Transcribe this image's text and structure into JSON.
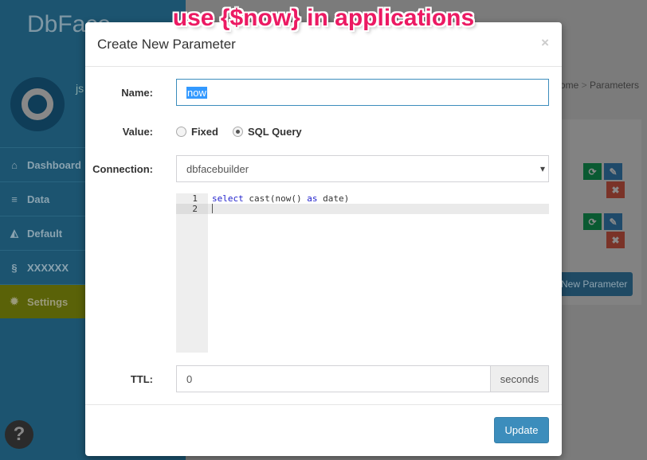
{
  "app": {
    "brand": "DbFace",
    "user": "js"
  },
  "sidebar": {
    "items": [
      {
        "label": "Dashboard",
        "icon": "home-icon"
      },
      {
        "label": "Data",
        "icon": "database-icon"
      },
      {
        "label": "Default",
        "icon": "area-chart-icon"
      },
      {
        "label": "XXXXXX",
        "icon": "unlink-icon"
      },
      {
        "label": "Settings",
        "icon": "gear-icon",
        "active": true
      }
    ]
  },
  "breadcrumb": {
    "home": "ome",
    "sep": ">",
    "current": "Parameters"
  },
  "page": {
    "new_parameter": "New Parameter"
  },
  "banner": "use {$now} in applications",
  "modal": {
    "title": "Create New Parameter",
    "close": "×",
    "name_label": "Name:",
    "name_value": "now",
    "value_label": "Value:",
    "options": [
      "Fixed",
      "SQL Query"
    ],
    "selected_option": "SQL Query",
    "connection_label": "Connection:",
    "connection_value": "dbfacebuilder",
    "caret": "▾",
    "editor": {
      "line_numbers": [
        "1",
        "2"
      ],
      "line1_kw1": "select",
      "line1_mid": " cast(now() ",
      "line1_kw2": "as",
      "line1_end": " date)"
    },
    "ttl_label": "TTL:",
    "ttl_value": "0",
    "ttl_unit": "seconds",
    "update": "Update"
  },
  "help": "?",
  "colors": {
    "primary": "#3c8dbc",
    "banner": "#ec1a63",
    "sidebar": "#1c5470"
  }
}
